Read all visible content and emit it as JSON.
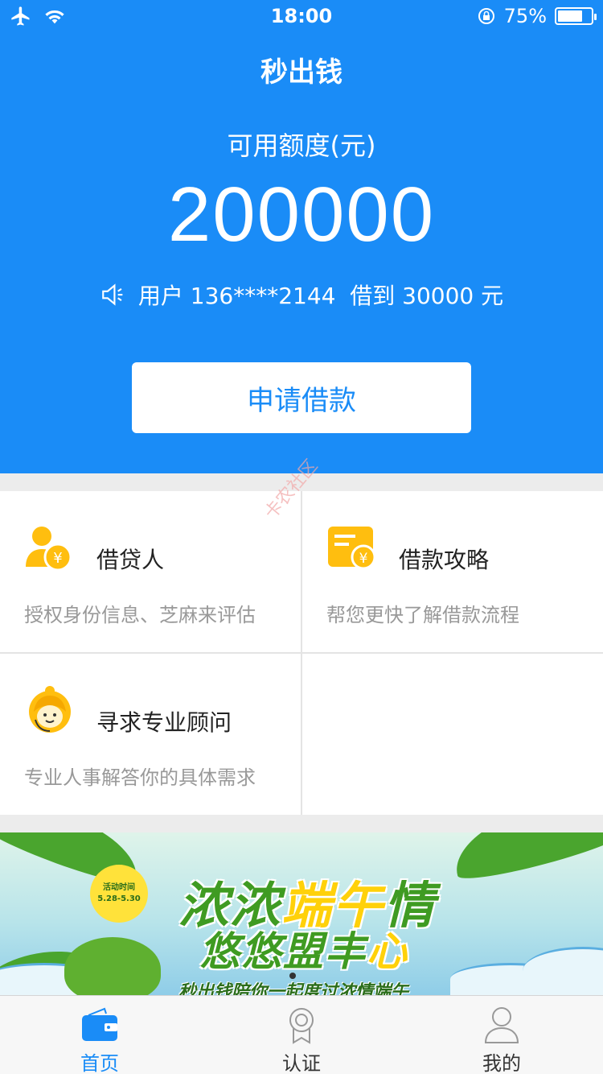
{
  "status_bar": {
    "time": "18:00",
    "battery_percent": "75%",
    "battery_level": 0.75
  },
  "header": {
    "title": "秒出钱",
    "quota_label": "可用额度(元)",
    "quota_value": "200000",
    "notice": "用户 136****2144  借到 30000 元",
    "apply_button": "申请借款"
  },
  "grid": {
    "items": [
      {
        "title": "借贷人",
        "desc": "授权身份信息、芝麻来评估",
        "icon": "borrower-icon"
      },
      {
        "title": "借款攻略",
        "desc": "帮您更快了解借款流程",
        "icon": "guide-card-icon"
      },
      {
        "title": "寻求专业顾问",
        "desc": "专业人事解答你的具体需求",
        "icon": "advisor-icon"
      },
      {
        "title": "",
        "desc": "",
        "icon": "more-icon"
      }
    ]
  },
  "watermark": "卡农社区",
  "banner": {
    "badge_line1": "活动时间",
    "badge_line2": "5.28-5.30",
    "title1_a": "浓浓",
    "title1_b": "端午",
    "title1_c": "情",
    "title2_a": "悠悠盟丰",
    "title2_b": "心",
    "subtitle": "秒出钱陪你一起度过浓情端午"
  },
  "tabbar": {
    "tabs": [
      {
        "label": "首页",
        "icon": "wallet-icon",
        "active": true
      },
      {
        "label": "认证",
        "icon": "certificate-icon",
        "active": false
      },
      {
        "label": "我的",
        "icon": "user-icon",
        "active": false
      }
    ]
  },
  "colors": {
    "primary": "#1a8cf7",
    "accent_yellow": "#ffbe0f"
  }
}
